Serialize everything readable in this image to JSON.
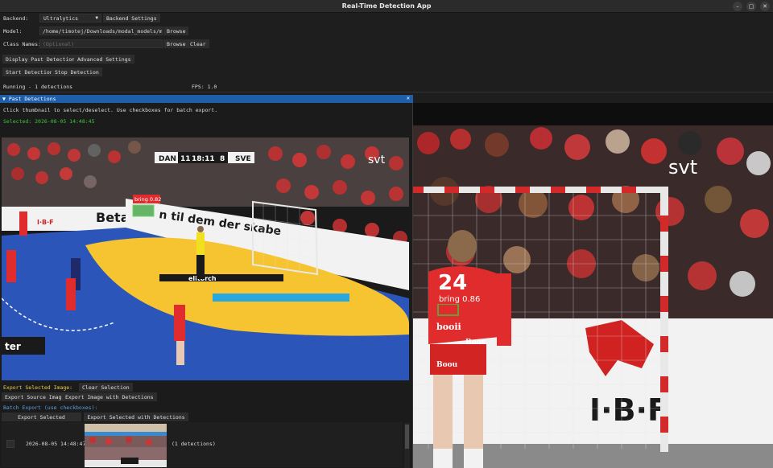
{
  "window": {
    "title": "Real-Time Detection App",
    "controls": {
      "minimize": "–",
      "maximize": "▢",
      "close": "✕"
    }
  },
  "controls": {
    "backend_label": "Backend:",
    "backend_value": "Ultralytics",
    "backend_settings": "Backend Settings",
    "model_label": "Model:",
    "model_path": "/home/timotej/Downloads/modal_models/model",
    "model_browse": "Browse",
    "class_label": "Class Names:",
    "class_placeholder": "(Optional)",
    "class_browse": "Browse",
    "class_clear": "Clear",
    "display_past": "Display Past Detections",
    "advanced_settings": "Advanced Settings",
    "start_detection": "Start Detection",
    "stop_detection": "Stop Detection",
    "status": "Running - 1 detections",
    "fps": "FPS: 1.0"
  },
  "panel": {
    "title": "Past Detections",
    "close": "✕",
    "hint": "Click thumbnail to select/deselect. Use checkboxes for batch export.",
    "selected": "Selected: 2026-08-05 14:48:45",
    "export_selected_image_label": "Export Selected Image:",
    "clear_selection": "Clear Selection",
    "export_source_image": "Export Source Image",
    "export_image_with_detections": "Export Image with Detections",
    "batch_export_label": "Batch Export (use checkboxes):",
    "export_selected": "Export Selected",
    "export_selected_with_detections": "Export Selected with Detections",
    "rows": [
      {
        "timestamp": "2026-08-05 14:48:47",
        "count": "(1 detections)"
      }
    ]
  },
  "detections": {
    "feed_label": "bring 0.86",
    "thumb_label": "bring 0.82"
  },
  "scene": {
    "score_home": "DAN",
    "score_home_goals": "11",
    "score_clock": "18:11",
    "score_away_goals": "8",
    "score_away": "SVE",
    "broadcaster": "svt",
    "ad_betano": "Betan",
    "ad_banner": "n til dem der skabe",
    "ad_sponsor": "I·B·F",
    "court_logo": "elitorch",
    "ad_board_left": "ter",
    "jersey_number": "24",
    "jersey_text_1": "booii",
    "jersey_text_2": "Boos",
    "shorts_text": "Boou"
  },
  "colors": {
    "accent": "#1f5ea8",
    "selected_text": "#3ec43e",
    "export_label": "#e6d24a",
    "batch_label": "#5aa0e6",
    "detection_box": "#3ec43e"
  }
}
